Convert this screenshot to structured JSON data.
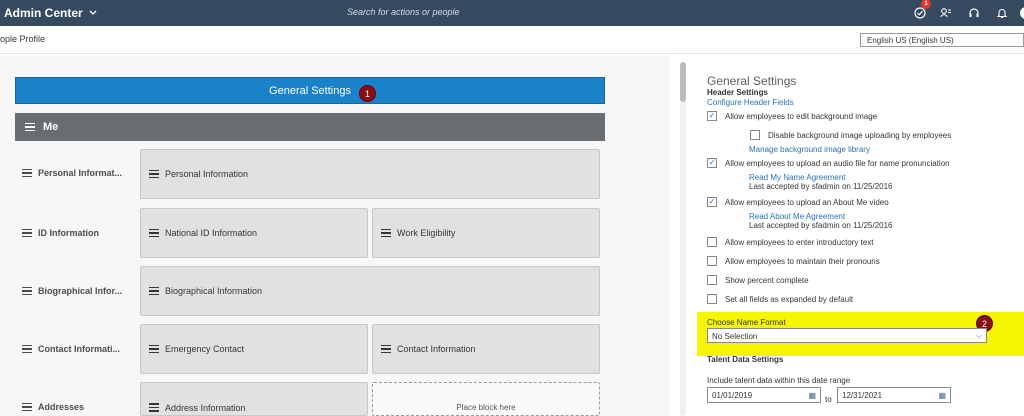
{
  "topbar": {
    "app_title": "Admin Center",
    "search_placeholder": "Search for actions or people",
    "notification_count": "1"
  },
  "subbar": {
    "page_title": "ople Profile",
    "language": "English US (English US)"
  },
  "left": {
    "general_settings_label": "General Settings",
    "marker1": "1",
    "me_label": "Me",
    "rows": [
      {
        "label": "Personal Informat...",
        "blocks": [
          "Personal Information"
        ]
      },
      {
        "label": "ID Information",
        "blocks": [
          "National ID Information",
          "Work Eligibility"
        ]
      },
      {
        "label": "Biographical Infor...",
        "blocks": [
          "Biographical Information"
        ]
      },
      {
        "label": "Contact Informati...",
        "blocks": [
          "Emergency Contact",
          "Contact Information"
        ]
      },
      {
        "label": "Addresses",
        "blocks": [
          "Address Information"
        ],
        "placeholder": "Place block here"
      }
    ]
  },
  "right": {
    "title": "General Settings",
    "header_settings": "Header Settings",
    "configure_link": "Configure Header Fields",
    "options": [
      {
        "label": "Allow employees to edit background image",
        "checked": true
      },
      {
        "label": "Disable background image uploading by employees",
        "checked": false
      },
      {
        "label": "Allow employees to upload an audio file for name pronunciation",
        "checked": true
      },
      {
        "label": "Allow employees to upload an About Me video",
        "checked": true
      },
      {
        "label": "Allow employees to enter introductory text",
        "checked": false
      },
      {
        "label": "Allow employees to maintain their pronouns",
        "checked": false
      },
      {
        "label": "Show percent complete",
        "checked": false
      },
      {
        "label": "Set all fields as expanded by default",
        "checked": false
      }
    ],
    "manage_bg_link": "Manage background image library",
    "read_name_link": "Read My Name Agreement",
    "name_accepted": "Last accepted by sfadmin on 11/25/2016",
    "read_about_link": "Read About Me Agreement",
    "about_accepted": "Last accepted by sfadmin on 11/25/2016",
    "choose_name_format": "Choose Name Format",
    "marker2": "2",
    "name_format_value": "No Selection",
    "talent_title": "Talent Data Settings",
    "range_label": "Include talent data within this date range",
    "date_from": "01/01/2019",
    "to_label": "to",
    "date_to": "12/31/2021"
  },
  "colors": {
    "topbar": "#354a5f",
    "primary_button": "#1a82c9",
    "me_bar": "#6a6d70",
    "highlight": "#f5f500",
    "marker": "#8a0d14"
  }
}
